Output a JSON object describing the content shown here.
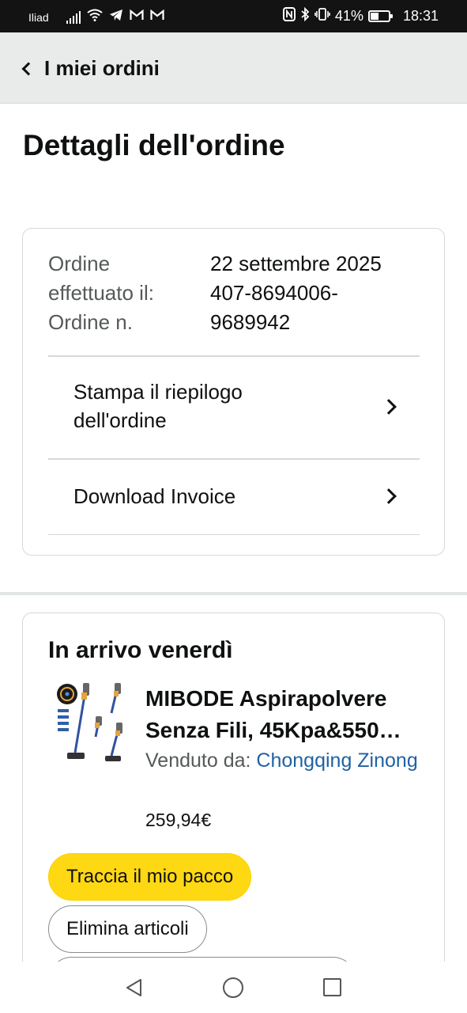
{
  "status_bar": {
    "carrier": "Iliad",
    "battery_percent": "41%",
    "battery_level": 0.41,
    "time": "18:31",
    "icons": [
      "signal-icon",
      "wifi-icon",
      "telegram-icon",
      "gmail-icon",
      "gmail-icon",
      "nfc-icon",
      "bluetooth-icon",
      "vibrate-icon",
      "battery-icon"
    ]
  },
  "header": {
    "back_label": "I miei ordini"
  },
  "page": {
    "title": "Dettagli dell'ordine"
  },
  "order_info": {
    "label_lines": [
      "Ordine",
      "effettuato il:",
      "Ordine n."
    ],
    "value_lines": [
      "22 settembre 2025",
      "407-8694006-",
      "9689942"
    ]
  },
  "actions": {
    "print_summary_lines": [
      "Stampa il riepilogo",
      "dell'ordine"
    ],
    "download_invoice": "Download Invoice"
  },
  "shipment": {
    "delivery_title": "In arrivo venerdì",
    "product_title": "MIBODE Aspirapolvere Senza Fili, 45Kpa&550…",
    "seller_prefix": "Venduto da: ",
    "seller_name": "Chongqing Zinong",
    "price": "259,94€",
    "track_button": "Traccia il mio pacco",
    "delete_button": "Elimina articoli"
  },
  "colors": {
    "primary_button": "#ffd814",
    "link": "#2162a1",
    "status_bar": "#131313",
    "header_bg": "#e9eaea"
  }
}
